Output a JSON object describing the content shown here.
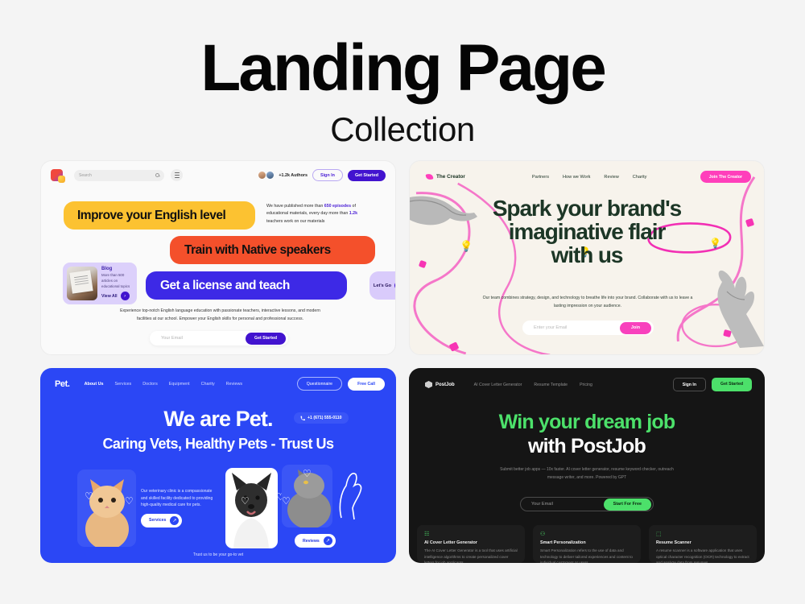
{
  "header": {
    "title": "Landing Page",
    "subtitle": "Collection"
  },
  "cards": {
    "english": {
      "logo_name": "english-app-logo",
      "search_placeholder": "Search",
      "authors_count": "+1.2k Authors",
      "sign_in": "Sign In",
      "get_started": "Get Started",
      "bar_yellow": "Improve your English level",
      "bar_red": "Train with Native speakers",
      "bar_blue": "Get a license and teach",
      "note_pre": "We have published more than ",
      "note_hl1": "650 episodes",
      "note_mid": " of educational materials, every day more than ",
      "note_hl2": "1.2k",
      "note_post": " teachers work on our materials",
      "blog_title": "Blog",
      "blog_desc": "More than 500 articles on educational topics",
      "blog_link": "View All",
      "lets_go": "Let's Go",
      "description": "Experience top-notch English language education with passionate teachers, interactive lessons, and modern facilities at our school. Empower your English skills for personal and professional success.",
      "email_placeholder": "Your Email",
      "email_button": "Get Started"
    },
    "creator": {
      "brand": "The Creator",
      "nav": [
        "Partners",
        "How we Work",
        "Review",
        "Charity"
      ],
      "cta": "Join The Creator",
      "headline_line1": "Spark your brand's",
      "headline_line2": "imaginative flair",
      "headline_line3": "with us",
      "description": "Our team combines strategy, design, and technology to breathe life into your brand. Collaborate with us to leave a lasting impression on your audience.",
      "email_placeholder": "Enter your Email",
      "email_button": "Join",
      "accent": "#ff3fbb",
      "headline_color": "#1c3626",
      "bg": "#f7f3ec"
    },
    "pet": {
      "brand": "Pet.",
      "nav": [
        "About Us",
        "Services",
        "Doctors",
        "Equipment",
        "Charity",
        "Reviews"
      ],
      "btn_outline": "Questionnaire",
      "btn_solid": "Free Call",
      "headline": "We are Pet.",
      "subheadline": "Caring Vets, Healthy Pets - Trust Us",
      "phone": "+1 (671) 555-0110",
      "description": "Our veterinary clinic is a compassionate and skilled facility dedicated to providing high-quality medical care for pets.",
      "services_button": "Services",
      "reviews_button": "Reviews",
      "footer": "Trust us to be your go-to vet",
      "bg": "#2b47f5"
    },
    "postjob": {
      "brand": "PostJob",
      "nav": [
        "AI Cover Letter Generator",
        "Resume Template",
        "Pricing"
      ],
      "sign_in": "Sign In",
      "get_started": "Get Started",
      "headline_line1": "Win your dream job",
      "headline_line2": "with PostJob",
      "description": "Submit better job apps — 10x faster. AI cover letter generator, resume keyword checker, outreach message writer, and more. Powered by GPT",
      "email_placeholder": "Your Email",
      "email_button": "Start For Free",
      "accent": "#4ce06a",
      "bg": "#151515",
      "features": [
        {
          "icon": "document-icon",
          "glyph": "☷",
          "title": "AI Cover Letter Generator",
          "desc": "The AI Cover Letter Generator is a tool that uses artificial intelligence algorithms to create personalized cover letters for job applicants."
        },
        {
          "icon": "people-icon",
          "glyph": "⚇",
          "title": "Smart Personalization",
          "desc": "Smart Personalization refers to the use of data and technology to deliver tailored experiences and content to individual customers or users."
        },
        {
          "icon": "scan-icon",
          "glyph": "⬚",
          "title": "Resume Scanner",
          "desc": "A resume scanner is a software application that uses optical character recognition (OCR) technology to extract and analyze data from resumes."
        }
      ]
    }
  }
}
